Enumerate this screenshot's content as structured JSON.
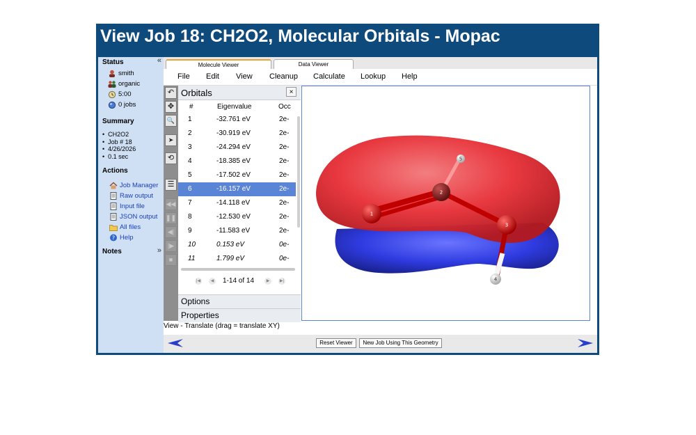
{
  "title": "View Job 18: CH2O2, Molecular Orbitals - Mopac",
  "sidebar": {
    "collapse_top": "«",
    "collapse_notes": "»",
    "status_heading": "Status",
    "status": [
      {
        "icon": "user-icon",
        "label": "smith"
      },
      {
        "icon": "group-icon",
        "label": "organic"
      },
      {
        "icon": "clock-icon",
        "label": "5:00"
      },
      {
        "icon": "jobs-icon",
        "label": "0 jobs"
      }
    ],
    "summary_heading": "Summary",
    "summary": [
      "CH2O2",
      "Job # 18",
      "4/26/2026",
      "0.1 sec"
    ],
    "actions_heading": "Actions",
    "actions": [
      {
        "icon": "home-icon",
        "label": "Job Manager"
      },
      {
        "icon": "document-icon",
        "label": "Raw output"
      },
      {
        "icon": "document-icon",
        "label": "Input file"
      },
      {
        "icon": "document-icon",
        "label": "JSON output"
      },
      {
        "icon": "folder-icon",
        "label": "All files"
      },
      {
        "icon": "help-icon",
        "label": "Help"
      }
    ],
    "notes_heading": "Notes"
  },
  "tabs": [
    {
      "label": "Molecule Viewer",
      "active": true
    },
    {
      "label": "Data Viewer",
      "active": false
    }
  ],
  "menu": [
    "File",
    "Edit",
    "View",
    "Cleanup",
    "Calculate",
    "Lookup",
    "Help"
  ],
  "toolbar": {
    "tools": [
      {
        "name": "rotate-tool-icon",
        "glyph": "↶"
      },
      {
        "name": "translate-tool-icon",
        "glyph": "✥"
      },
      {
        "name": "zoom-tool-icon",
        "glyph": "🔍"
      },
      {
        "name": "select-tool-icon",
        "glyph": "➤"
      },
      {
        "name": "spin-tool-icon",
        "glyph": "⟲"
      },
      {
        "name": "list-tool-icon",
        "glyph": "☰"
      }
    ],
    "playback": [
      {
        "name": "rewind-icon",
        "glyph": "◀◀"
      },
      {
        "name": "pause-icon",
        "glyph": "❚❚"
      },
      {
        "name": "step-back-icon",
        "glyph": "◀|"
      },
      {
        "name": "step-forward-icon",
        "glyph": "|▶"
      },
      {
        "name": "stop-icon",
        "glyph": "■"
      }
    ]
  },
  "orbitals": {
    "title": "Orbitals",
    "close": "×",
    "columns": [
      "#",
      "Eigenvalue",
      "Occ"
    ],
    "selected": 6,
    "rows": [
      {
        "n": "1",
        "e": "-32.761 eV",
        "occ": "2e-"
      },
      {
        "n": "2",
        "e": "-30.919 eV",
        "occ": "2e-"
      },
      {
        "n": "3",
        "e": "-24.294 eV",
        "occ": "2e-"
      },
      {
        "n": "4",
        "e": "-18.385 eV",
        "occ": "2e-"
      },
      {
        "n": "5",
        "e": "-17.502 eV",
        "occ": "2e-"
      },
      {
        "n": "6",
        "e": "-16.157 eV",
        "occ": "2e-"
      },
      {
        "n": "7",
        "e": "-14.118 eV",
        "occ": "2e-"
      },
      {
        "n": "8",
        "e": "-12.530 eV",
        "occ": "2e-"
      },
      {
        "n": "9",
        "e": "-11.583 eV",
        "occ": "2e-"
      },
      {
        "n": "10",
        "e": "0.153 eV",
        "occ": "0e-"
      },
      {
        "n": "11",
        "e": "1.799 eV",
        "occ": "0e-"
      }
    ],
    "pager": "1-14 of 14",
    "sections": [
      "Options",
      "Properties"
    ]
  },
  "molecule": {
    "colors": {
      "positive": "#e8323a",
      "negative": "#2f3be0",
      "bond": "#c80000",
      "carbon": "#555555",
      "hydrogen": "#f2f2f2"
    },
    "atoms": [
      {
        "label": "1",
        "element": "O"
      },
      {
        "label": "2",
        "element": "C"
      },
      {
        "label": "3",
        "element": "O"
      },
      {
        "label": "4",
        "element": "H"
      },
      {
        "label": "5",
        "element": "H"
      }
    ]
  },
  "status_text": "View - Translate (drag = translate XY)",
  "buttons": {
    "reset": "Reset Viewer",
    "new_job": "New Job Using This Geometry"
  },
  "accent": "#0e4a7c"
}
